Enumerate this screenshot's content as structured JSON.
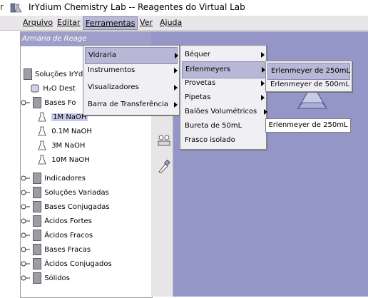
{
  "window": {
    "title": "IrYdium Chemistry Lab -- Reagentes do Virtual Lab",
    "edge_glyph": "r"
  },
  "menubar": {
    "items": [
      "Arquivo",
      "Editar",
      "Ferramentas",
      "Ver",
      "Ajuda"
    ]
  },
  "left_panel": {
    "header": "Armário de Reage",
    "tree": {
      "solutions_root": "Soluções IrYd",
      "h2o": "H₂O Dest",
      "bases_fortes": "Bases Fo",
      "naoh_1m": "1M NaOH",
      "naoh_01m": "0.1M NaOH",
      "naoh_3m": "3M NaOH",
      "naoh_10m": "10M NaOH",
      "groups": [
        "Indicadores",
        "Soluções Variadas",
        "Bases Conjugadas",
        "Ácidos Fortes",
        "Ácidos Fracos",
        "Bases Fracas",
        "Ácidos Conjugados",
        "Sólidos"
      ]
    }
  },
  "ferramentas_menu": {
    "items": [
      "Vidraria",
      "Instrumentos",
      "Visualizadores",
      "Barra de Transferência"
    ]
  },
  "vidraria_menu": {
    "items": [
      "Béquer",
      "Erlenmeyers",
      "Provetas",
      "Pipetas",
      "Balões Volumétricos",
      "Bureta de 50mL",
      "Frasco isolado"
    ]
  },
  "erlenmeyers_menu": {
    "items": [
      "Erlenmeyer de 250mL",
      "Erlenmeyer de 500mL"
    ]
  },
  "tooltip": {
    "text": "Erlenmeyer de 250mL"
  },
  "colors": {
    "canvas": "#9596c8",
    "highlight": "#b8b8d6",
    "header": "#9d9fc9"
  }
}
